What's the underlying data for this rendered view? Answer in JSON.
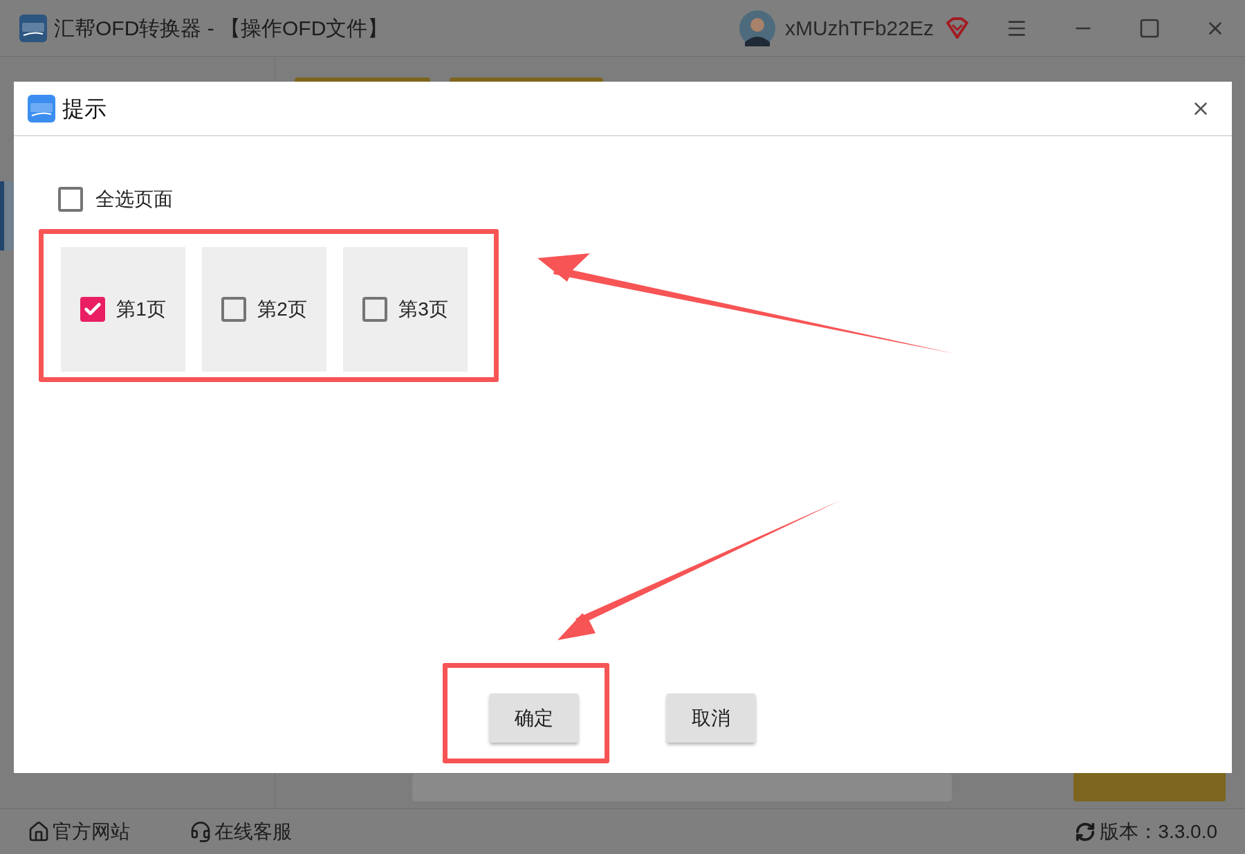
{
  "app": {
    "title": "汇帮OFD转换器 - 【操作OFD文件】",
    "user": "xMUzhTFb22Ez"
  },
  "dialog": {
    "title": "提示",
    "select_all": {
      "label": "全选页面",
      "checked": false
    },
    "pages": [
      {
        "label": "第1页",
        "checked": true
      },
      {
        "label": "第2页",
        "checked": false
      },
      {
        "label": "第3页",
        "checked": false
      }
    ],
    "buttons": [
      "确定",
      "取消"
    ]
  },
  "footer": {
    "links": [
      "官方网站",
      "在线客服"
    ],
    "version": "版本：3.3.0.0"
  }
}
